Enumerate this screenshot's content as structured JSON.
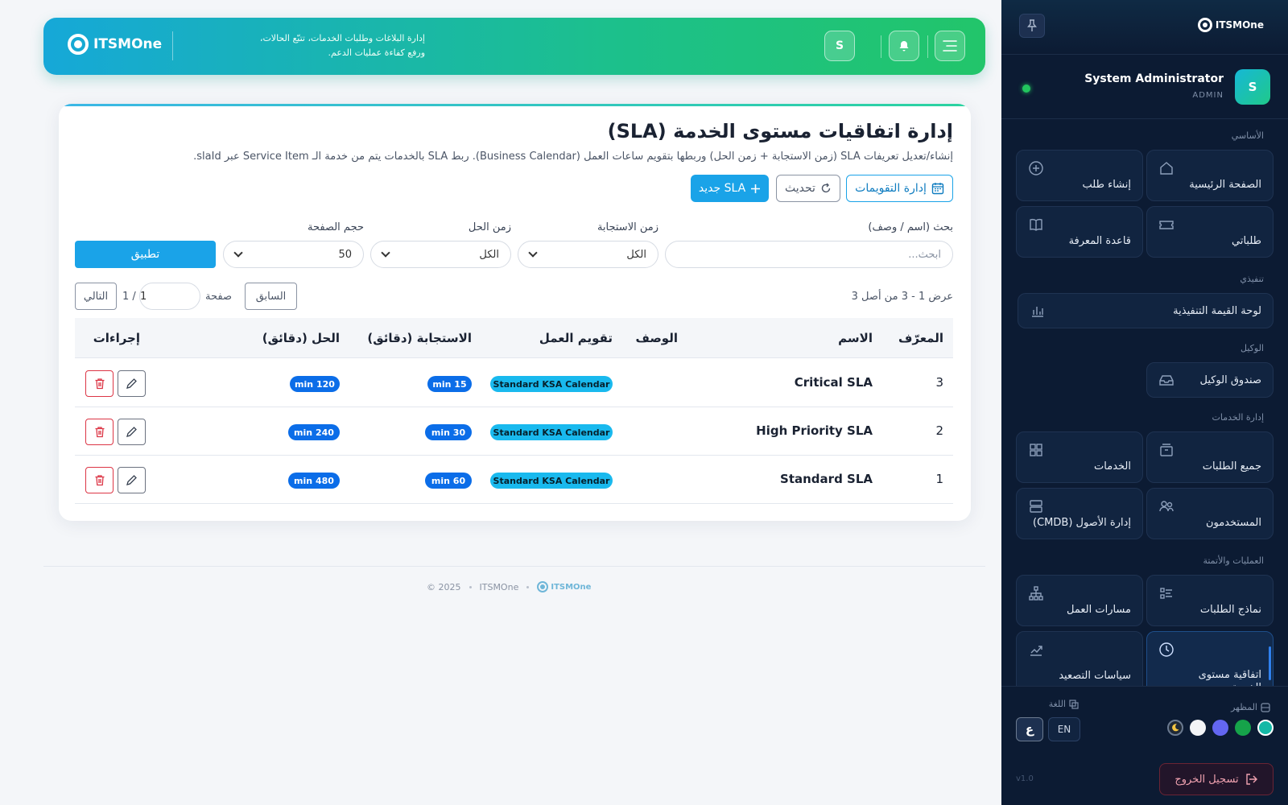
{
  "header": {
    "logo": "ITSMOne",
    "tagline_line1": "إدارة البلاغات وطلبات الخدمات، تتبّع الحالات،",
    "tagline_line2": "ورفع كفاءة عمليات الدعم.",
    "avatar_letter": "S"
  },
  "sidebar": {
    "logo": "ITSMOne",
    "user": {
      "avatar": "S",
      "name": "System Administrator",
      "role": "ADMIN"
    },
    "sections": {
      "basic": "الأساسي",
      "executive": "تنفيذي",
      "agent": "الوكيل",
      "service_mgmt": "إدارة الخدمات",
      "ops": "العمليات والأتمتة"
    },
    "items": {
      "home": "الصفحة الرئيسية",
      "create_request": "إنشاء طلب",
      "my_requests": "طلباتي",
      "knowledge": "قاعدة المعرفة",
      "exec_dashboard": "لوحة القيمة التنفيذية",
      "agent_inbox": "صندوق الوكيل",
      "all_requests": "جميع الطلبات",
      "services": "الخدمات",
      "users": "المستخدمون",
      "cmdb": "إدارة الأصول (CMDB)",
      "request_forms": "نماذج الطلبات",
      "workflows": "مسارات العمل",
      "sla": "اتفاقية مستوى الخدمة",
      "escalation": "سياسات التصعيد"
    },
    "appearance_label": "المظهر",
    "language_label": "اللغة",
    "lang_ar": "ع",
    "lang_en": "EN",
    "logout": "تسجيل الخروج",
    "version": "v1.0",
    "swatch_colors": [
      "#14b8a6",
      "#16a34a",
      "#6366f1",
      "#f3f4f6",
      "#1f2937"
    ]
  },
  "page": {
    "title": "إدارة اتفاقيات مستوى الخدمة (SLA)",
    "subtitle": "إنشاء/تعديل تعريفات SLA (زمن الاستجابة + زمن الحل) وربطها بتقويم ساعات العمل (Business Calendar). ربط SLA بالخدمات يتم من خدمة الـ Service Item عبر slaId.",
    "btn_calendars": "إدارة التقويمات",
    "btn_refresh": "تحديث",
    "btn_new": "SLA جديد"
  },
  "filters": {
    "search_label": "بحث (اسم / وصف)",
    "search_placeholder": "ابحث...",
    "response_label": "زمن الاستجابة",
    "response_value": "الكل",
    "resolution_label": "زمن الحل",
    "resolution_value": "الكل",
    "pagesize_label": "حجم الصفحة",
    "pagesize_value": "50",
    "apply": "تطبيق"
  },
  "pagination": {
    "count_text": "عرض 1 - 3 من أصل 3",
    "prev": "السابق",
    "page_label": "صفحة",
    "page_value": "1",
    "total": "/ 1",
    "next": "التالي"
  },
  "table": {
    "columns": {
      "id": "المعرّف",
      "name": "الاسم",
      "description": "الوصف",
      "calendar": "تقويم العمل",
      "response": "الاستجابة (دقائق)",
      "resolution": "الحل (دقائق)",
      "actions": "إجراءات"
    },
    "rows": [
      {
        "id": "3",
        "name": "Critical SLA",
        "description": "",
        "calendar": "Standard KSA Calendar",
        "response": "15 min",
        "resolution": "120 min"
      },
      {
        "id": "2",
        "name": "High Priority SLA",
        "description": "",
        "calendar": "Standard KSA Calendar",
        "response": "30 min",
        "resolution": "240 min"
      },
      {
        "id": "1",
        "name": "Standard SLA",
        "description": "",
        "calendar": "Standard KSA Calendar",
        "response": "60 min",
        "resolution": "480 min"
      }
    ]
  },
  "footer": {
    "logo": "ITSMOne",
    "brand": "ITSMOne",
    "copyright": "© 2025"
  }
}
